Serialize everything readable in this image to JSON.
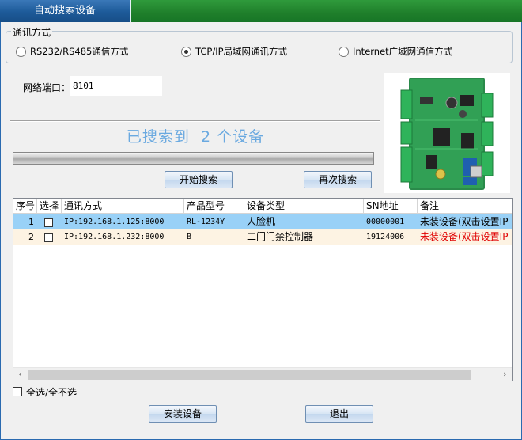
{
  "window": {
    "title": "自动搜索设备"
  },
  "comm_group": {
    "legend": "通讯方式",
    "options": [
      {
        "label": "RS232/RS485通信方式",
        "selected": false
      },
      {
        "label": "TCP/IP局域网通讯方式",
        "selected": true
      },
      {
        "label": "Internet广域网通信方式",
        "selected": false
      }
    ]
  },
  "port": {
    "label": "网络端口：",
    "value": "8101"
  },
  "search": {
    "status": "已搜索到  2 个设备",
    "start_label": "开始搜索",
    "again_label": "再次搜索"
  },
  "table": {
    "columns": [
      "序号",
      "选择",
      "通讯方式",
      "产品型号",
      "设备类型",
      "SN地址",
      "备注"
    ],
    "rows": [
      {
        "no": "1",
        "checked": false,
        "comm": "IP:192.168.1.125:8000",
        "model": "RL-1234Y",
        "type": "人脸机",
        "sn": "00000001",
        "note": "未装设备(双击设置IP"
      },
      {
        "no": "2",
        "checked": false,
        "comm": "IP:192.168.1.232:8000",
        "model": "B",
        "type": "二门门禁控制器",
        "sn": "19124006",
        "note": "未装设备(双击设置IP"
      }
    ]
  },
  "footer": {
    "select_all_label": "全选/全不选",
    "install_label": "安装设备",
    "exit_label": "退出"
  },
  "colors": {
    "title_blue": "#1d5a99",
    "title_green": "#1f7f2b",
    "selected_row": "#99d1f7",
    "note_red": "#e00000"
  },
  "image": {
    "icon": "access-control-board-pcb"
  }
}
